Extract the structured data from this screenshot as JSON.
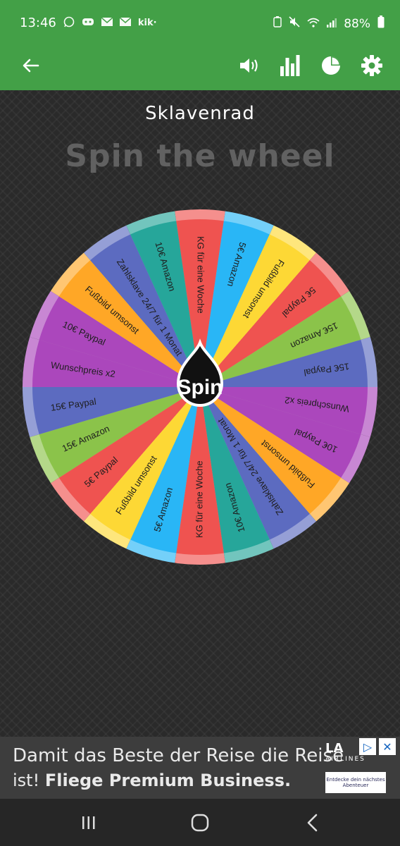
{
  "status_bar": {
    "time": "13:46",
    "left_icons": [
      "whatsapp-icon",
      "discord-icon",
      "mail-icon",
      "mail-icon",
      "kik-icon"
    ],
    "kik_text": "kik·",
    "battery_percent": "88%"
  },
  "app_bar": {
    "icons": [
      "volume-icon",
      "bar-chart-icon",
      "pie-chart-icon",
      "settings-icon"
    ]
  },
  "wheel": {
    "name": "Sklavenrad",
    "title": "Spin the wheel",
    "spin_label": "Spin",
    "segments": [
      {
        "label": "KG für eine Woche",
        "color": "#ef5350"
      },
      {
        "label": "5€ Amazon",
        "color": "#29b6f6"
      },
      {
        "label": "Fußbild umsonst",
        "color": "#fdd835"
      },
      {
        "label": "5€ Paypal",
        "color": "#ef5350"
      },
      {
        "label": "15€ Amazon",
        "color": "#8bc34a"
      },
      {
        "label": "15€ Paypal",
        "color": "#5c6bc0"
      },
      {
        "label": "Wunschpreis x2",
        "color": "#ab47bc"
      },
      {
        "label": "10€ Paypal",
        "color": "#ab47bc"
      },
      {
        "label": "Fußbild umsonst",
        "color": "#ffa726"
      },
      {
        "label": "Zahlsklave 24/7 für 1 Monat",
        "color": "#5c6bc0"
      },
      {
        "label": "10€ Amazon",
        "color": "#26a69a"
      },
      {
        "label": "KG für eine Woche",
        "color": "#ef5350"
      },
      {
        "label": "5€ Amazon",
        "color": "#29b6f6"
      },
      {
        "label": "Fußbild umsonst",
        "color": "#fdd835"
      },
      {
        "label": "5€ Paypal",
        "color": "#ef5350"
      },
      {
        "label": "15€ Amazon",
        "color": "#8bc34a"
      },
      {
        "label": "15€ Paypal",
        "color": "#5c6bc0"
      },
      {
        "label": "Wunschpreis x2",
        "color": "#ab47bc"
      },
      {
        "label": "10€ Paypal",
        "color": "#ab47bc"
      },
      {
        "label": "Fußbild umsonst",
        "color": "#ffa726"
      },
      {
        "label": "Zahlsklave 24/7 für 1 Monat",
        "color": "#5c6bc0"
      },
      {
        "label": "10€ Amazon",
        "color": "#26a69a"
      }
    ]
  },
  "ad": {
    "line1": "Damit das Beste der Reise die Reise",
    "line2_plain": "ist!",
    "line2_bold": "Fliege Premium Business.",
    "logo_text": "LA",
    "logo_sub": "AIRLINES",
    "cta_text": "Entdecke dein nächstes Abenteuer"
  },
  "nav_bar": {
    "icons": [
      "recent-apps-icon",
      "home-icon",
      "back-icon"
    ]
  },
  "colors": {
    "accent": "#43a047",
    "background": "#2a2a2a"
  }
}
